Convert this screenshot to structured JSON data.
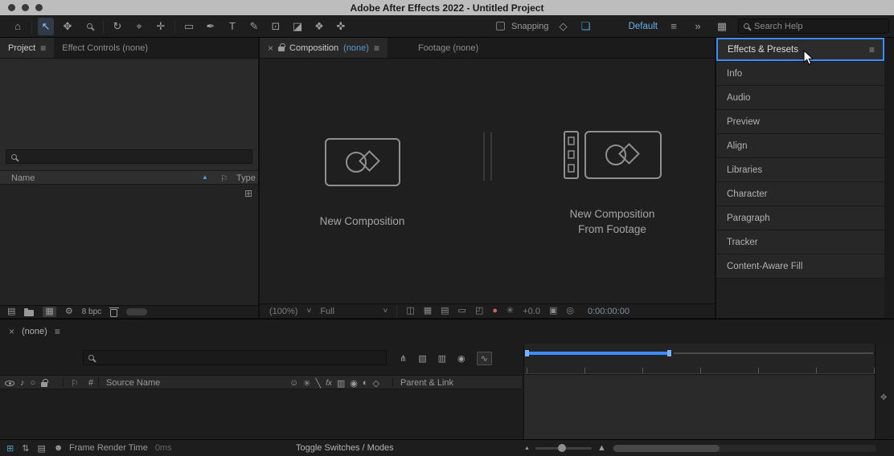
{
  "titlebar": {
    "title": "Adobe After Effects 2022 - Untitled Project"
  },
  "toolbar": {
    "snapping_label": "Snapping",
    "workspace_label": "Default",
    "search_placeholder": "Search Help"
  },
  "project": {
    "tab_project": "Project",
    "tab_effect_controls": "Effect Controls (none)",
    "col_name": "Name",
    "col_type": "Type",
    "bpc_label": "8 bpc"
  },
  "composition": {
    "tab_label": "Composition",
    "tab_value": "(none)",
    "footage_tab_label": "Footage (none)",
    "new_comp_label": "New Composition",
    "new_comp_footage_line1": "New Composition",
    "new_comp_footage_line2": "From Footage",
    "magnification": "(100%)",
    "resolution": "Full",
    "exposure": "+0.0",
    "timecode": "0:00:00:00"
  },
  "right_panels": {
    "selected_label": "Effects & Presets",
    "items": [
      "Info",
      "Audio",
      "Preview",
      "Align",
      "Libraries",
      "Character",
      "Paragraph",
      "Tracker",
      "Content-Aware Fill"
    ]
  },
  "timeline": {
    "tab_label": "(none)",
    "col_number": "#",
    "col_source_name": "Source Name",
    "col_parent": "Parent & Link",
    "frame_render_label": "Frame Render Time",
    "frame_render_value": "0ms",
    "toggle_switches_label": "Toggle Switches / Modes"
  },
  "icons": {
    "close": "×",
    "menu": "≡",
    "caret_down": "˅",
    "more_chevron": "»",
    "home": "⌂",
    "selection_tool": "↖",
    "hand_tool": "✥",
    "orbit_tool": "↻",
    "camera_tool": "⌖",
    "pan_behind_tool": "✛",
    "rectangle_tool": "▭",
    "pen_tool": "✒",
    "type_tool": "T",
    "brush_tool": "✎",
    "clone_tool": "⊡",
    "eraser_tool": "◪",
    "roto_tool": "❖",
    "puppet_tool": "✜",
    "snap_option_a": "◇",
    "snap_option_b": "❏",
    "panel_grid": "▦",
    "sort_up": "▲",
    "tag": "⚐",
    "flowchart": "⊞",
    "interpret": "▤",
    "new_comp": "▦",
    "settings_gear": "⚙",
    "audio": "♪",
    "solo": "○",
    "shy": "☺",
    "collapse": "✳",
    "quality": "╲",
    "fx": "fx",
    "frame_blend": "▥",
    "motion_blur": "◉",
    "adjustment": "◐",
    "threed": "◇",
    "mini_flowchart": "⋔",
    "draft_3d": "▧",
    "graph_editor": "∿",
    "safe_zones": "◫",
    "grid": "▦",
    "guides": "▤",
    "mask_vis": "▭",
    "roi": "◰",
    "channel": "●",
    "reset_exposure": "✳",
    "snapshot": "▣",
    "show_snapshot": "◎",
    "frames": "⊞",
    "updown": "⇅",
    "columns": "▤",
    "people": "☻",
    "mountain": "▲",
    "pan_mini": "✥"
  },
  "colors": {
    "accent_blue": "#3d8bff",
    "link_blue": "#5b9bd5",
    "workspace_blue": "#6cb2e8",
    "channel_red": "#d85c5c"
  }
}
